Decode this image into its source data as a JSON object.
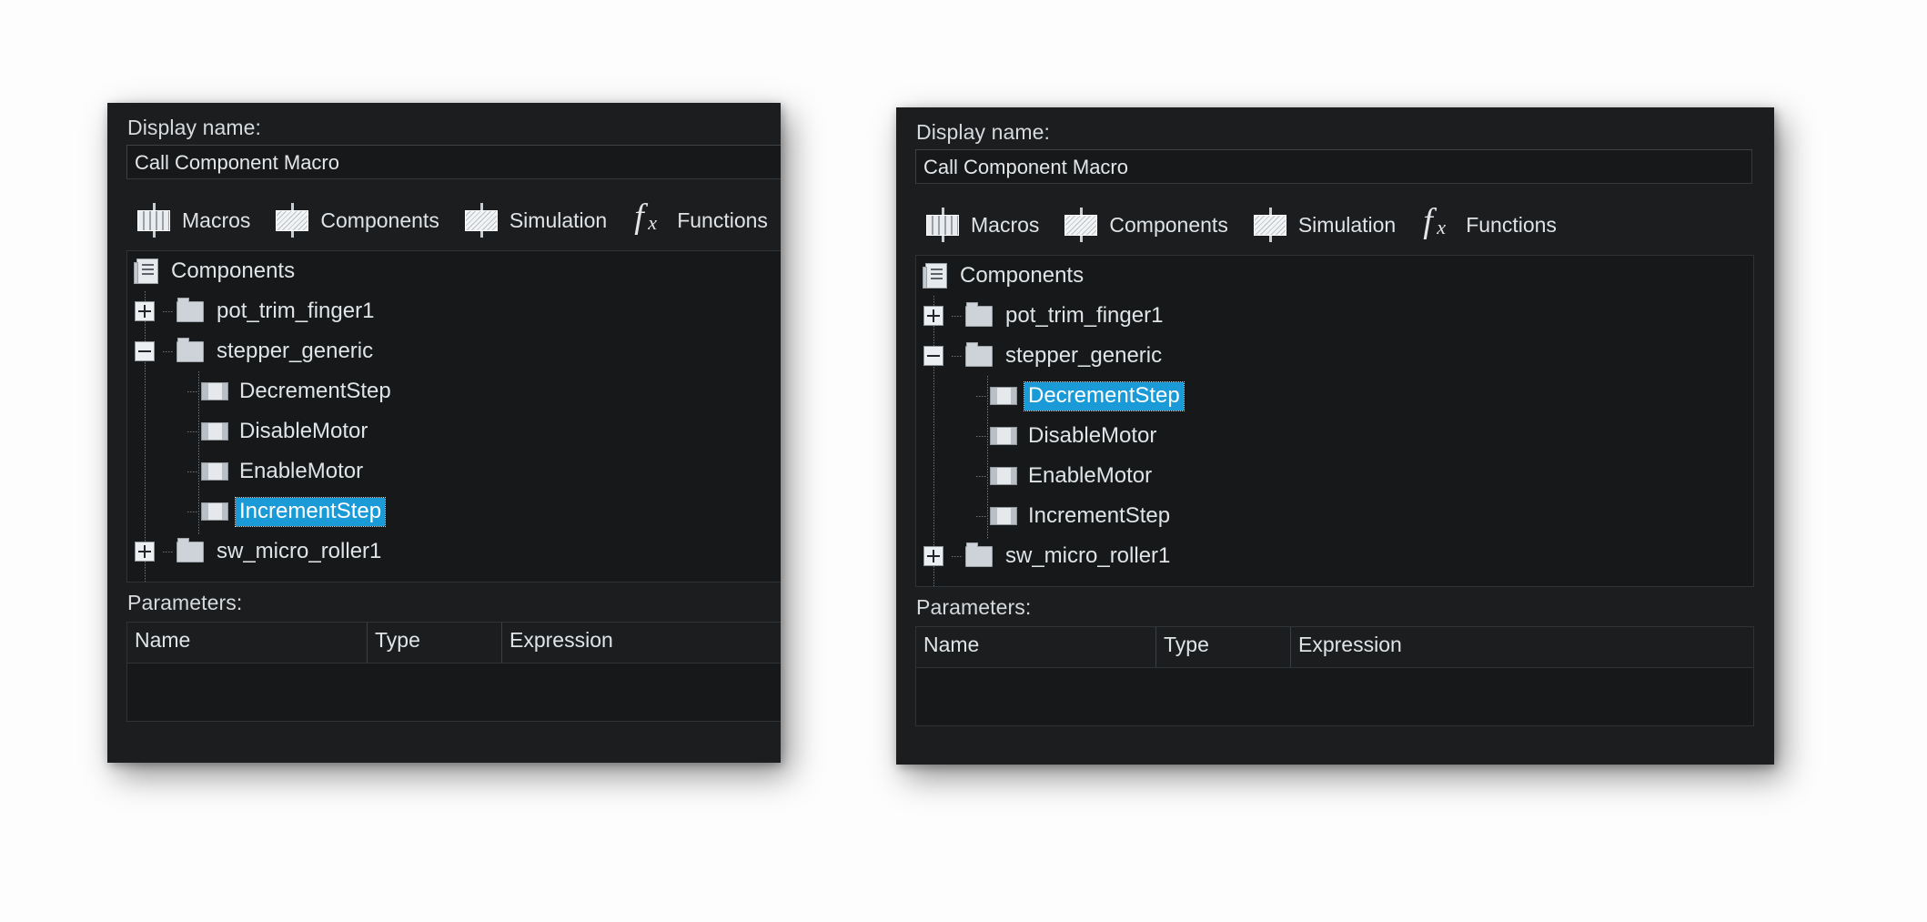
{
  "dialog": {
    "display_name_label": "Display name:",
    "display_name_value": "Call Component Macro",
    "parameters_label": "Parameters:",
    "toolbar": [
      {
        "label": "Macros",
        "icon": "component-bars-icon"
      },
      {
        "label": "Components",
        "icon": "component-hatch-icon"
      },
      {
        "label": "Simulation",
        "icon": "component-hatch-icon"
      },
      {
        "label": "Functions",
        "icon": "fx-icon"
      }
    ],
    "tree": {
      "root_label": "Components",
      "nodes": [
        {
          "label": "pot_trim_finger1",
          "expander": "plus",
          "icon": "folder-icon",
          "depth": 1
        },
        {
          "label": "stepper_generic",
          "expander": "minus",
          "icon": "folder-icon",
          "depth": 1
        },
        {
          "label": "DecrementStep",
          "expander": "none",
          "icon": "macro-icon",
          "depth": 2
        },
        {
          "label": "DisableMotor",
          "expander": "none",
          "icon": "macro-icon",
          "depth": 2
        },
        {
          "label": "EnableMotor",
          "expander": "none",
          "icon": "macro-icon",
          "depth": 2
        },
        {
          "label": "IncrementStep",
          "expander": "none",
          "icon": "macro-icon",
          "depth": 2
        },
        {
          "label": "sw_micro_roller1",
          "expander": "plus",
          "icon": "folder-icon",
          "depth": 1
        }
      ]
    },
    "parameters_columns": [
      "Name",
      "Type",
      "Expression"
    ],
    "selection_color": "#1a9ad6"
  },
  "panels": {
    "left": {
      "selected_node": "IncrementStep"
    },
    "right": {
      "selected_node": "DecrementStep"
    }
  }
}
